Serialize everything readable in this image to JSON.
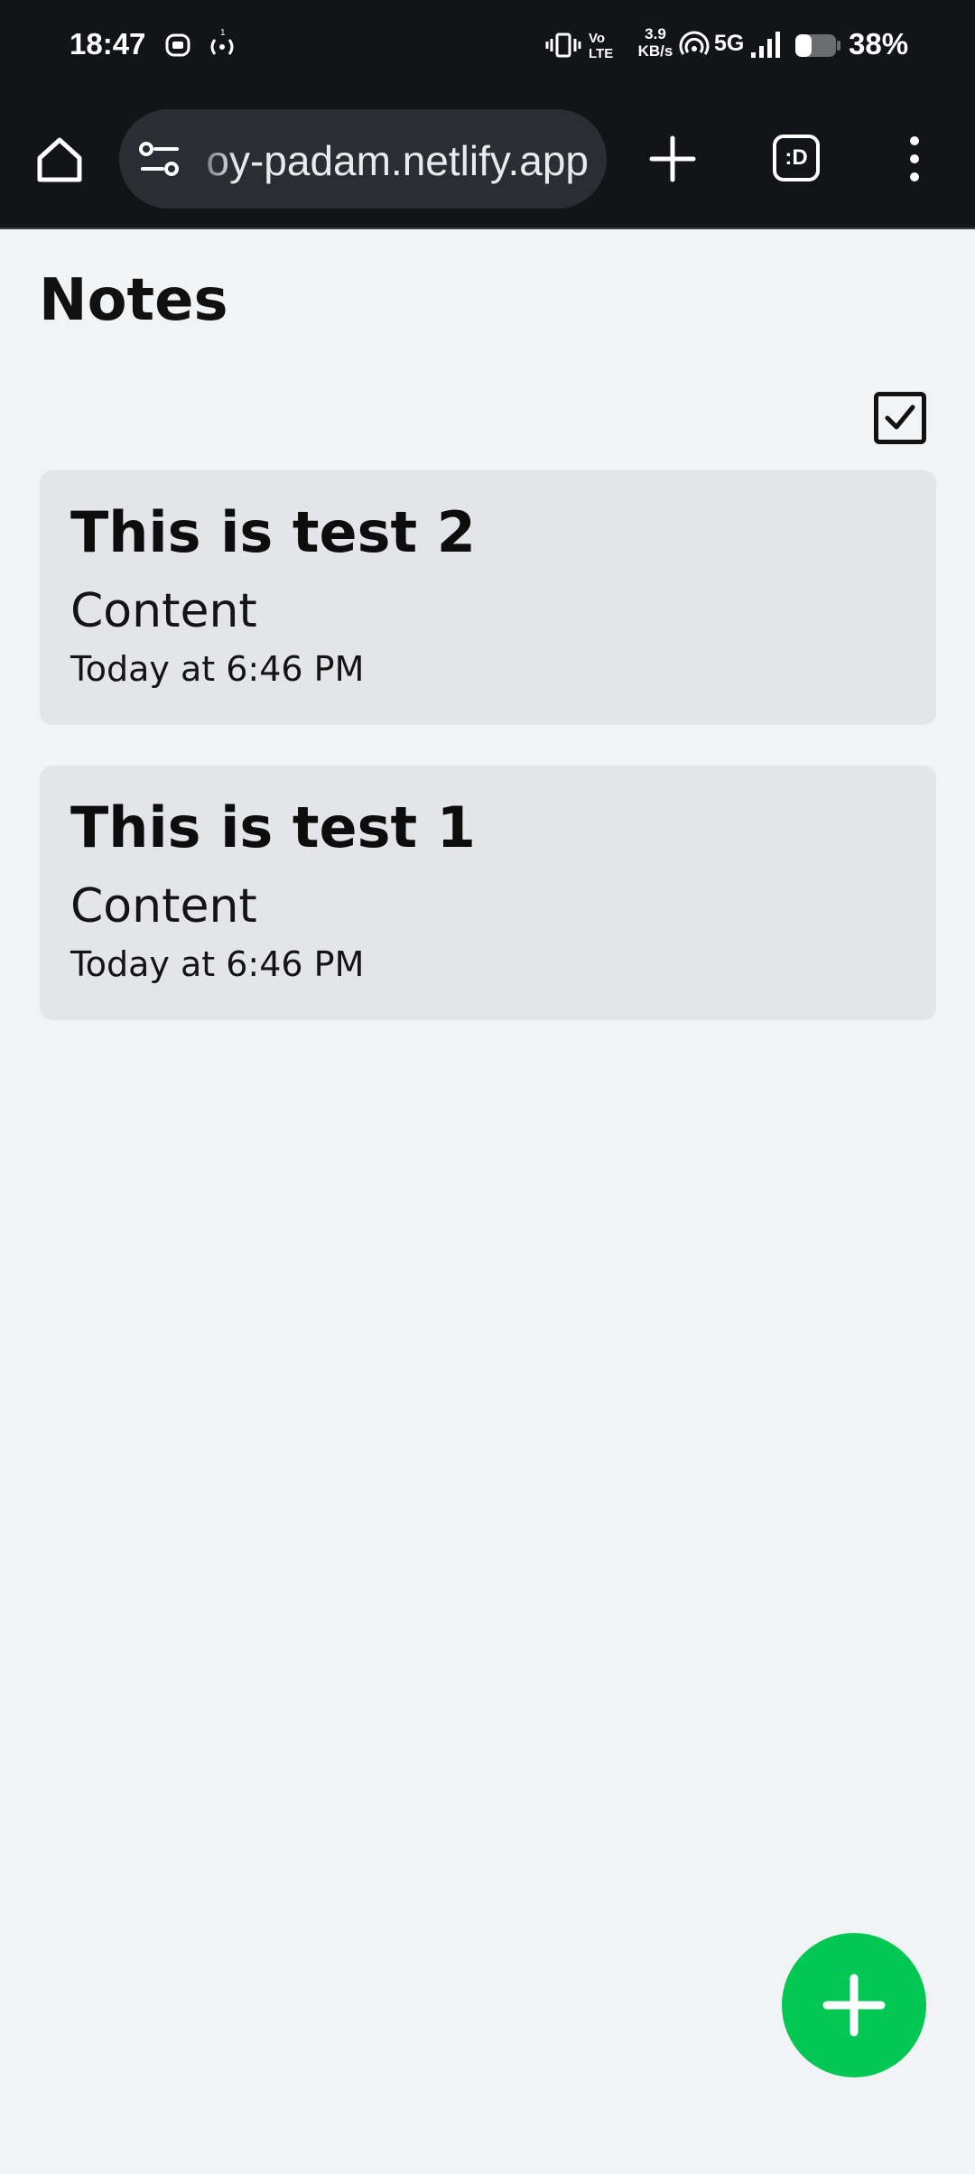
{
  "status_bar": {
    "time": "18:47",
    "net_speed_value": "3.9",
    "net_speed_unit": "KB/s",
    "network_type": "5G",
    "battery": "38%",
    "icons": [
      "notification-icon",
      "hotspot-icon",
      "vibrate-icon",
      "volte-icon",
      "wifi-calling-icon",
      "signal-icon",
      "battery-icon"
    ]
  },
  "browser": {
    "url": "oy-padam.netlify.app",
    "tab_count_label": ":D",
    "icons": [
      "home-icon",
      "site-settings-icon",
      "new-tab-icon",
      "tabs-icon",
      "more-menu-icon"
    ]
  },
  "page": {
    "title": "Notes"
  },
  "notes": [
    {
      "title": "This is test 2",
      "content": "Content",
      "date": "Today at 6:46 PM"
    },
    {
      "title": "This is test 1",
      "content": "Content",
      "date": "Today at 6:46 PM"
    }
  ],
  "colors": {
    "accent": "#00c853",
    "card_bg": "#e4e5e8",
    "page_bg": "#f2f3f5",
    "browser_chrome": "#121418"
  }
}
